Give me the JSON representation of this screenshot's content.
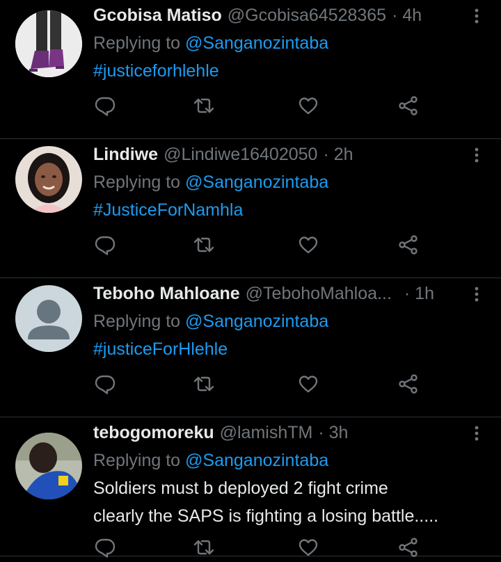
{
  "tweets": [
    {
      "name": "Gcobisa Matiso",
      "handle": "@Gcobisa64528365",
      "time": "· 4h",
      "replying_label": "Replying to",
      "replying_to": "@Sanganozintaba",
      "text": "#justiceforhlehle",
      "avatar": "boots-photo"
    },
    {
      "name": "Lindiwe",
      "handle": "@Lindiwe16402050",
      "time": "· 2h",
      "replying_label": "Replying to",
      "replying_to": "@Sanganozintaba",
      "text": "#JusticeForNamhla",
      "avatar": "woman-photo"
    },
    {
      "name": "Teboho Mahloane",
      "handle": "@TebohoMahloa...",
      "time": "· 1h",
      "replying_label": "Replying to",
      "replying_to": "@Sanganozintaba",
      "text": "#justiceForHlehle",
      "avatar": "default-avatar"
    },
    {
      "name": "tebogomoreku",
      "handle": "@lamishTM",
      "time": "· 3h",
      "replying_label": "Replying to",
      "replying_to": "@Sanganozintaba",
      "text_line1": "Soldiers must b deployed 2 fight crime",
      "text_line2": "clearly the SAPS is fighting a losing battle.....",
      "avatar": "man-photo"
    }
  ],
  "colors": {
    "background": "#000000",
    "primary_text": "#e7e9ea",
    "secondary_text": "#71767b",
    "link": "#1d9bf0",
    "divider": "#2f3336"
  },
  "icons": {
    "reply": "reply-icon",
    "retweet": "retweet-icon",
    "like": "like-icon",
    "share": "share-icon",
    "more": "more-icon"
  }
}
